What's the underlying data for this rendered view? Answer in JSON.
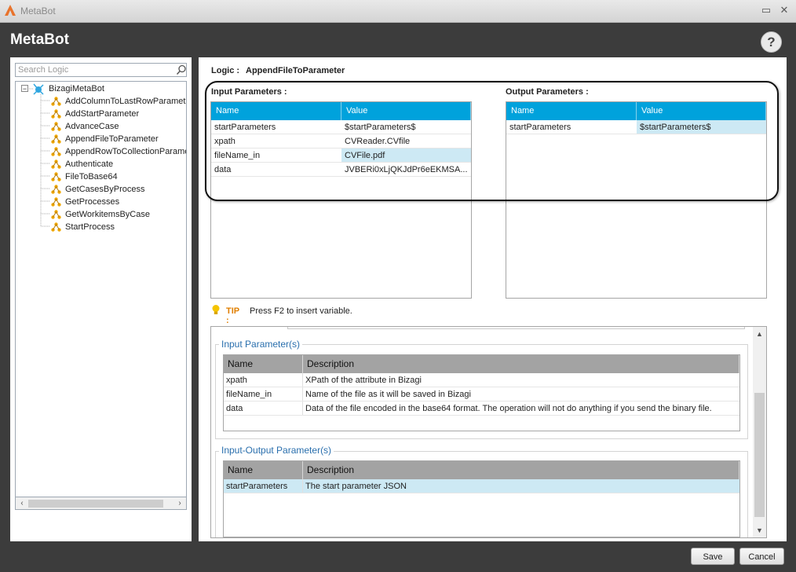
{
  "window": {
    "title": "MetaBot",
    "minimize_symbol": "▭",
    "close_symbol": "✕"
  },
  "header": {
    "title": "MetaBot",
    "help_label": "?"
  },
  "search": {
    "placeholder": "Search Logic"
  },
  "tree": {
    "root": {
      "label": "BizagiMetaBot",
      "expander": "−"
    },
    "items": [
      {
        "label": "AddColumnToLastRowParameter"
      },
      {
        "label": "AddStartParameter"
      },
      {
        "label": "AdvanceCase"
      },
      {
        "label": "AppendFileToParameter"
      },
      {
        "label": "AppendRowToCollectionParameter"
      },
      {
        "label": "Authenticate"
      },
      {
        "label": "FileToBase64"
      },
      {
        "label": "GetCasesByProcess"
      },
      {
        "label": "GetProcesses"
      },
      {
        "label": "GetWorkitemsByCase"
      },
      {
        "label": "StartProcess"
      }
    ]
  },
  "logic": {
    "label": "Logic :",
    "value": "AppendFileToParameter"
  },
  "input_params": {
    "title": "Input Parameters :",
    "columns": [
      "Name",
      "Value"
    ],
    "rows": [
      {
        "name": "startParameters",
        "value": "$startParameters$"
      },
      {
        "name": "xpath",
        "value": "CVReader.CVfile"
      },
      {
        "name": "fileName_in",
        "value": "CVFile.pdf"
      },
      {
        "name": "data",
        "value": "JVBERi0xLjQKJdPr6eEKMSA..."
      }
    ]
  },
  "output_params": {
    "title": "Output Parameters :",
    "columns": [
      "Name",
      "Value"
    ],
    "rows": [
      {
        "name": "startParameters",
        "value": "$startParameters$"
      }
    ]
  },
  "tip": {
    "label": "TIP :",
    "text": "Press F2 to insert variable."
  },
  "doc": {
    "input_section": {
      "legend": "Input Parameter(s)",
      "columns": [
        "Name",
        "Description"
      ],
      "rows": [
        {
          "name": "xpath",
          "description": "XPath of the attribute in Bizagi"
        },
        {
          "name": "fileName_in",
          "description": "Name of the file as it will be saved in Bizagi"
        },
        {
          "name": "data",
          "description": "Data of the file encoded in the base64 format. The operation will not do anything if you send the binary file."
        }
      ]
    },
    "io_section": {
      "legend": "Input-Output Parameter(s)",
      "columns": [
        "Name",
        "Description"
      ],
      "rows": [
        {
          "name": "startParameters",
          "description": "The start parameter JSON"
        }
      ]
    }
  },
  "buttons": {
    "save": "Save",
    "cancel": "Cancel"
  },
  "scroll": {
    "left": "‹",
    "right": "›",
    "up": "▲",
    "down": "▼"
  },
  "colors": {
    "accent_header": "#00a2dc",
    "selected_row": "#cde9f4",
    "tip_label": "#e07f00",
    "legend": "#2a6fad"
  }
}
